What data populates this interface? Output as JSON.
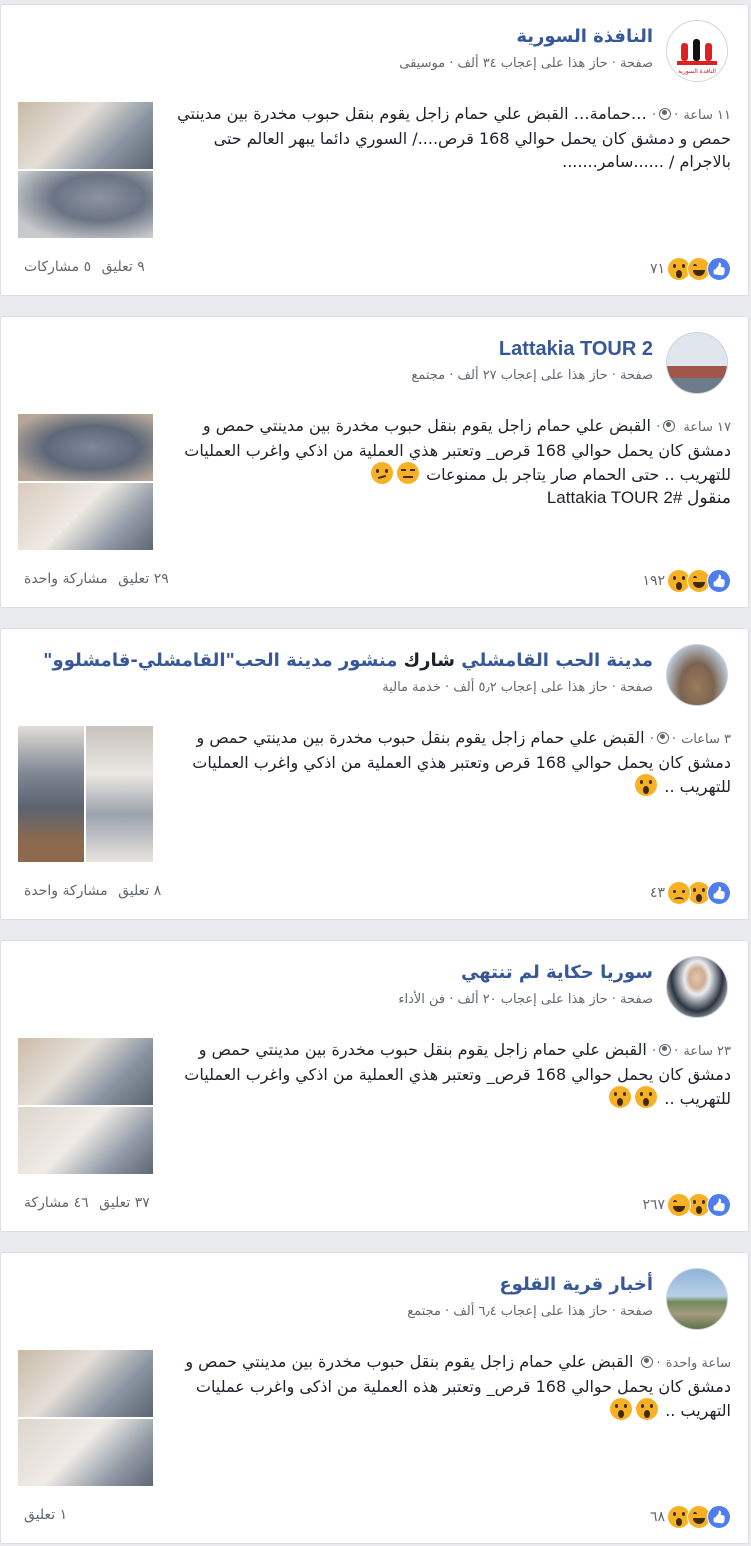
{
  "posts": [
    {
      "page_name": "النافذة السورية",
      "meta": "صفحة · حاز هذا على إعجاب ٣٤ ألف · موسيقى",
      "time": "١١ ساعة",
      "text": "…حمامة… القبض علي حمام زاجل يقوم بنقل حبوب مخدرة بين مدينتي حمص و دمشق كان يحمل حوالي 168 قرص..../ السوري دائما يبهر العالم حتى بالاجرام / ......سامر.......",
      "reaction_count": "٧١",
      "comments": "٩ تعليق",
      "shares": "٥ مشاركات",
      "reactions": [
        "like-icon",
        "haha-icon",
        "wow-icon"
      ]
    },
    {
      "page_name": "Lattakia TOUR 2",
      "meta": "صفحة · حاز هذا على إعجاب ٢٧ ألف · مجتمع",
      "time": "١٧ ساعة",
      "text": "القبض علي حمام زاجل يقوم بنقل حبوب مخدرة بين مدينتي حمص و دمشق كان يحمل حوالي 168 قرص_ وتعتبر هذي العملية من اذكي واغرب العمليات للتهريب .. حتى الحمام صار يتاجر بل ممنوعات",
      "text_line2": "منقول Lattakia TOUR 2#",
      "reaction_count": "١٩٢",
      "comments": "٢٩ تعليق",
      "shares": "مشاركة واحدة",
      "reactions": [
        "like-icon",
        "haha-icon",
        "wow-icon"
      ]
    },
    {
      "page_name": "مدينة الحب القامشلي",
      "share_word": "شارك",
      "shared_text": "منشور مدينة الحب\"القامشلي-قامشلوو\"",
      "meta": "صفحة · حاز هذا على إعجاب ٥٫٢ ألف · خدمة مالية",
      "time": "٣ ساعات",
      "text": "القبض علي حمام زاجل يقوم بنقل حبوب مخدرة بين مدينتي حمص و دمشق كان يحمل حوالي 168 قرص وتعتبر هذي العملية من اذكي واغرب العمليات للتهريب ..",
      "reaction_count": "٤٣",
      "comments": "٨ تعليق",
      "shares": "مشاركة واحدة",
      "reactions": [
        "like-icon",
        "wow-icon",
        "sad-icon"
      ]
    },
    {
      "page_name": "سوريا حكاية لم تنتهي",
      "meta": "صفحة · حاز هذا على إعجاب ٢٠ ألف · فن الأداء",
      "time": "٢٣ ساعة",
      "text": "القبض علي حمام زاجل يقوم بنقل حبوب مخدرة بين مدينتي حمص و دمشق كان يحمل حوالي 168 قرص_ وتعتبر هذي العملية من اذكي واغرب العمليات للتهريب ..",
      "reaction_count": "٢٦٧",
      "comments": "٣٧ تعليق",
      "shares": "٤٦ مشاركة",
      "reactions": [
        "like-icon",
        "wow-icon",
        "haha-icon"
      ]
    },
    {
      "page_name": "أخبار قرية القلوع",
      "meta": "صفحة · حاز هذا على إعجاب ٦٫٤ ألف · مجتمع",
      "time": "ساعة واحدة",
      "text": "القبض علي حمام زاجل يقوم بنقل حبوب مخدرة بين مدينتي حمص و دمشق كان يحمل حوالي 168 قرص_ وتعتبر هذه العملية من اذكى واغرب عمليات التهريب ..",
      "reaction_count": "٦٨",
      "comments": "١ تعليق",
      "shares": "",
      "reactions": [
        "like-icon",
        "haha-icon",
        "wow-icon"
      ]
    }
  ],
  "avatar1_logo_text": "النافذة السورية",
  "colors": {
    "link": "#365899",
    "meta": "#616770",
    "like": "#4f7df0",
    "emoji": "#f7b125"
  }
}
